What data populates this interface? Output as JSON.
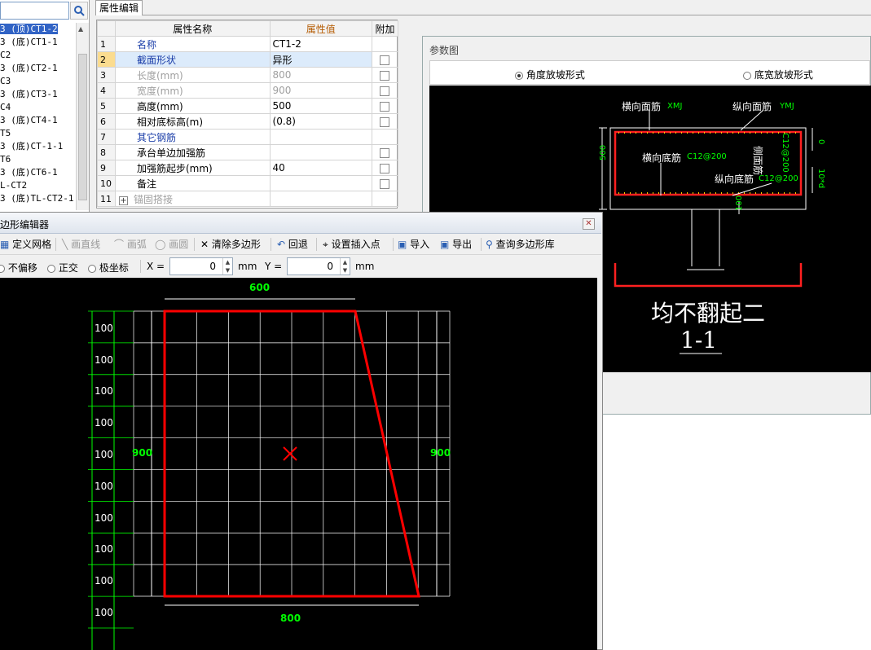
{
  "tree": {
    "items": [
      {
        "text": "(顶)CT1-2",
        "prefix": "3 ",
        "selected": true
      },
      {
        "text": "(底)CT1-1",
        "prefix": "3 "
      },
      {
        "text": "C2",
        "prefix": ""
      },
      {
        "text": "(底)CT2-1",
        "prefix": "3 "
      },
      {
        "text": "C3",
        "prefix": ""
      },
      {
        "text": "(底)CT3-1",
        "prefix": "3 "
      },
      {
        "text": "C4",
        "prefix": ""
      },
      {
        "text": "(底)CT4-1",
        "prefix": "3 "
      },
      {
        "text": "T5",
        "prefix": ""
      },
      {
        "text": "(底)CT-1-1",
        "prefix": "3 "
      },
      {
        "text": "T6",
        "prefix": ""
      },
      {
        "text": "(底)CT6-1",
        "prefix": "3 "
      },
      {
        "text": "L-CT2",
        "prefix": ""
      },
      {
        "text": "(底)TL-CT2-1",
        "prefix": "3 "
      }
    ]
  },
  "prop": {
    "tab": "属性编辑",
    "headers": {
      "name": "属性名称",
      "value": "属性值",
      "extra": "附加"
    },
    "rows": [
      {
        "n": "1",
        "name": "名称",
        "value": "CT1-2",
        "chk": false,
        "style": "blue"
      },
      {
        "n": "2",
        "name": "截面形状",
        "value": "异形",
        "chk": true,
        "style": "blue",
        "selected": true
      },
      {
        "n": "3",
        "name": "长度(mm)",
        "value": "800",
        "chk": true,
        "style": "gray"
      },
      {
        "n": "4",
        "name": "宽度(mm)",
        "value": "900",
        "chk": true,
        "style": "gray"
      },
      {
        "n": "5",
        "name": "高度(mm)",
        "value": "500",
        "chk": true,
        "style": ""
      },
      {
        "n": "6",
        "name": "相对底标高(m)",
        "value": "(0.8)",
        "chk": true,
        "style": ""
      },
      {
        "n": "7",
        "name": "其它钢筋",
        "value": "",
        "chk": false,
        "style": "blue"
      },
      {
        "n": "8",
        "name": "承台单边加强筋",
        "value": "",
        "chk": true,
        "style": ""
      },
      {
        "n": "9",
        "name": "加强筋起步(mm)",
        "value": "40",
        "chk": true,
        "style": ""
      },
      {
        "n": "10",
        "name": "备注",
        "value": "",
        "chk": true,
        "style": ""
      },
      {
        "n": "11",
        "name": "锚固搭接",
        "value": "",
        "chk": false,
        "style": "gray",
        "expand": "+"
      }
    ]
  },
  "param": {
    "title": "参数图",
    "radio1": "角度放坡形式",
    "radio2": "底宽放坡形式",
    "fig": {
      "top_bar": "横向面筋",
      "top_bar_code": "XMJ",
      "long_top": "纵向面筋",
      "long_top_code": "YMJ",
      "bottom_bar": "横向底筋",
      "bottom_bar_code": "C12@200",
      "long_bottom": "纵向底筋",
      "long_bottom_code": "C12@200",
      "side": "侧面筋",
      "side_code": "C12@200",
      "dim_height": "500",
      "dim_zero": "0",
      "dim_10d": "10*d",
      "dim_100": "100",
      "caption": "均不翻起二",
      "section": "1-1"
    }
  },
  "poly": {
    "title": "多边形编辑器",
    "toolbar": {
      "define_grid": "定义网格",
      "draw_line": "画直线",
      "draw_arc": "画弧",
      "draw_circle": "画圆",
      "clear": "清除多边形",
      "undo": "回退",
      "insert_point": "设置插入点",
      "import": "导入",
      "export": "导出",
      "query": "查询多边形库"
    },
    "options": {
      "no_offset": "不偏移",
      "ortho": "正交",
      "polar": "极坐标",
      "x_label": "X =",
      "x_value": "0",
      "y_label": "Y =",
      "y_value": "0",
      "unit": "mm"
    },
    "canvas": {
      "top_dim": "600",
      "bottom_dim": "800",
      "left_dim": "900",
      "right_dim": "900",
      "row_labels": [
        "100",
        "100",
        "100",
        "100",
        "100",
        "100",
        "100",
        "100",
        "100",
        "100"
      ]
    }
  },
  "colors": {
    "accent": "#3163c5",
    "shape": "#ff0000",
    "grid": "#ffffff",
    "dim": "#00ff00"
  }
}
